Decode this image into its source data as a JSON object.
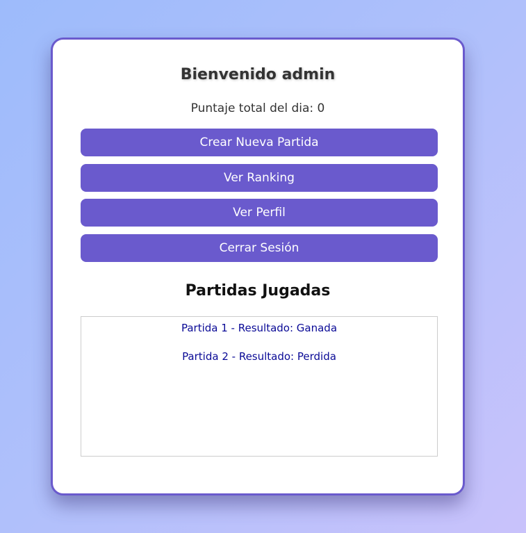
{
  "welcome": {
    "title": "Bienvenido admin",
    "score_text": "Puntaje total del dia: 0"
  },
  "actions": {
    "create_game": "Crear Nueva Partida",
    "ranking": "Ver Ranking",
    "profile": "Ver Perfil",
    "logout": "Cerrar Sesión"
  },
  "games": {
    "title": "Partidas Jugadas",
    "items": [
      "Partida 1 - Resultado: Ganada",
      "Partida 2 - Resultado: Perdida"
    ]
  },
  "colors": {
    "accent": "#6a5acd",
    "link_text": "#0a0a96"
  }
}
